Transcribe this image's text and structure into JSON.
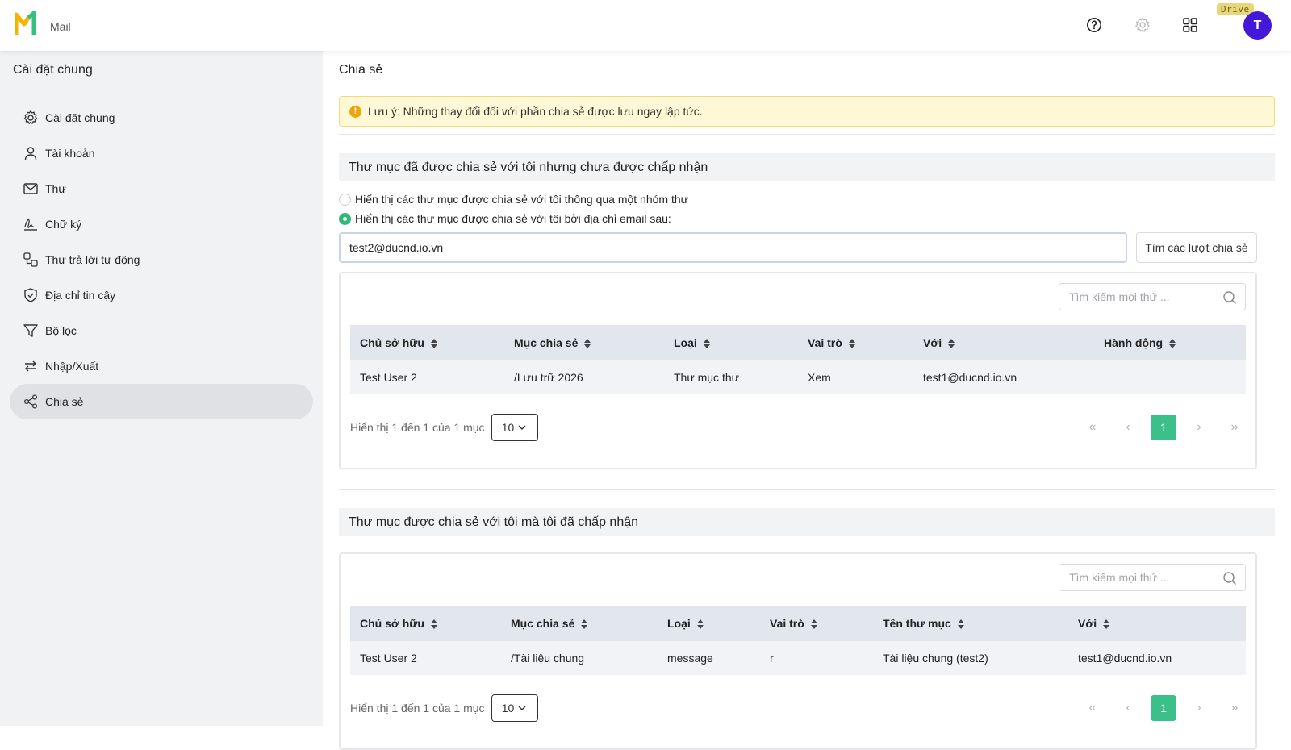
{
  "header": {
    "app_name": "Mail",
    "drive_badge": "Drive",
    "avatar_letter": "T",
    "brand_colors": {
      "logo_green": "#35c17d",
      "logo_yellow": "#f5b400",
      "avatar": "#4318d8"
    }
  },
  "sidebar": {
    "title": "Cài đặt chung",
    "items": [
      {
        "label": "Cài đặt chung",
        "icon": "gear-icon"
      },
      {
        "label": "Tài khoản",
        "icon": "user-icon"
      },
      {
        "label": "Thư",
        "icon": "mail-icon"
      },
      {
        "label": "Chữ ký",
        "icon": "signature-icon"
      },
      {
        "label": "Thư trả lời tự động",
        "icon": "auto-reply-icon"
      },
      {
        "label": "Địa chỉ tin cậy",
        "icon": "shield-icon"
      },
      {
        "label": "Bộ lọc",
        "icon": "filter-icon"
      },
      {
        "label": "Nhập/Xuất",
        "icon": "import-export-icon"
      },
      {
        "label": "Chia sẻ",
        "icon": "share-icon",
        "active": true
      }
    ]
  },
  "main": {
    "title": "Chia sẻ",
    "notice": "Lưu ý: Những thay đổi đối với phần chia sẻ được lưu ngay lập tức.",
    "pending": {
      "heading": "Thư mục đã được chia sẻ với tôi nhưng chưa được chấp nhận",
      "radio_group": "Hiển thị các thư mục được chia sẻ với tôi thông qua một nhóm thư",
      "radio_email": "Hiển thị các thư mục được chia sẻ với tôi bởi địa chỉ email sau:",
      "email_value": "test2@ducnd.io.vn",
      "find_button": "Tìm các lượt chia sẻ",
      "search_placeholder": "Tìm kiếm mọi thứ ...",
      "columns": [
        "Chủ sở hữu",
        "Mục chia sẻ",
        "Loại",
        "Vai trò",
        "Với",
        "Hành động"
      ],
      "rows": [
        [
          "Test User 2",
          "/Lưu trữ 2026",
          "Thư mục thư",
          "Xem",
          "test1@ducnd.io.vn",
          ""
        ]
      ],
      "summary": "Hiển thị 1 đến 1 của 1 mục",
      "page_size": "10",
      "current_page": "1"
    },
    "accepted": {
      "heading": "Thư mục được chia sẻ với tôi mà tôi đã chấp nhận",
      "search_placeholder": "Tìm kiếm mọi thứ ...",
      "columns": [
        "Chủ sở hữu",
        "Mục chia sẻ",
        "Loại",
        "Vai trò",
        "Tên thư mục",
        "Với"
      ],
      "rows": [
        [
          "Test User 2",
          "/Tài liệu chung",
          "message",
          "r",
          "Tài liệu chung (test2)",
          "test1@ducnd.io.vn"
        ]
      ],
      "summary": "Hiển thị 1 đến 1 của 1 mục",
      "page_size": "10",
      "current_page": "1"
    },
    "accent_color": "#3cc08a"
  }
}
